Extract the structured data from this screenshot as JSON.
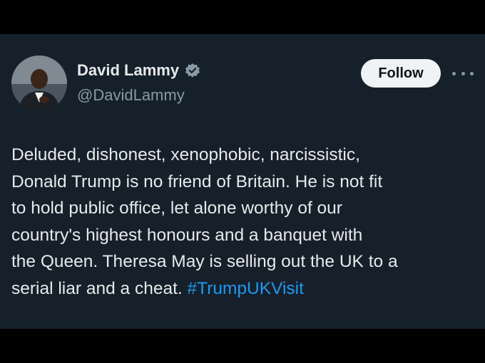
{
  "tweet": {
    "author": {
      "name": "David Lammy",
      "handle": "@DavidLammy",
      "verified": true,
      "avatar_icon": "person-avatar"
    },
    "follow_label": "Follow",
    "more_icon": "more-horizontal-icon",
    "text_lines": [
      "Deluded, dishonest, xenophobic, narcissistic,",
      "Donald Trump is no friend of Britain. He is not fit",
      "to hold public office, let alone worthy of our",
      "country's highest honours and a banquet with",
      "the Queen. Theresa May is selling out the UK to a"
    ],
    "last_line_text": "serial liar and a cheat.",
    "hashtag": "#TrumpUKVisit"
  },
  "colors": {
    "page_background": "#000000",
    "card_background": "#15202b",
    "text_primary": "#e7e9ea",
    "text_secondary": "#8b98a5",
    "hashtag": "#1d9bf0",
    "follow_button_bg": "#eff3f4"
  }
}
